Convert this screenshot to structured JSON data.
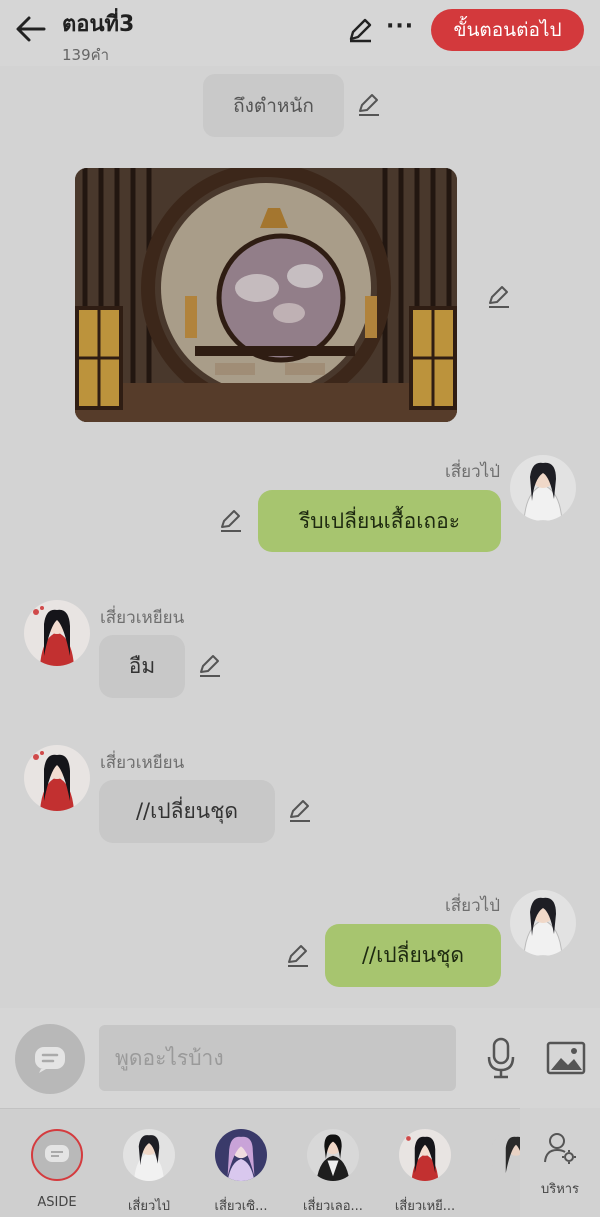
{
  "header": {
    "title": "ตอนที่3",
    "word_count": "139คำ",
    "next_label": "ขั้นตอนต่อไป",
    "more": "···"
  },
  "messages": {
    "narration": "ถึงตำหนัก",
    "m1_name": "เสี่ยวไป่",
    "m1_text": "รีบเปลี่ยนเสื้อเถอะ",
    "m2_name": "เสี่ยวเหยียน",
    "m2_text": "อืม",
    "m3_name": "เสี่ยวเหยียน",
    "m3_text": "//เปลี่ยนชุด",
    "m4_name": "เสี่ยวไป่",
    "m4_text": "//เปลี่ยนชุด"
  },
  "input": {
    "placeholder": "พูดอะไรบ้าง"
  },
  "characters": [
    {
      "label": "ASIDE"
    },
    {
      "label": "เสี่ยวไป่"
    },
    {
      "label": "เสี่ยวเซิ..."
    },
    {
      "label": "เสี่ยวเลอ..."
    },
    {
      "label": "เสี่ยวเหยี..."
    }
  ],
  "manage_label": "บริหาร",
  "colors": {
    "accent": "#d3393c",
    "my_bubble": "#a7c56f",
    "other_bubble": "#c8c8c8"
  }
}
